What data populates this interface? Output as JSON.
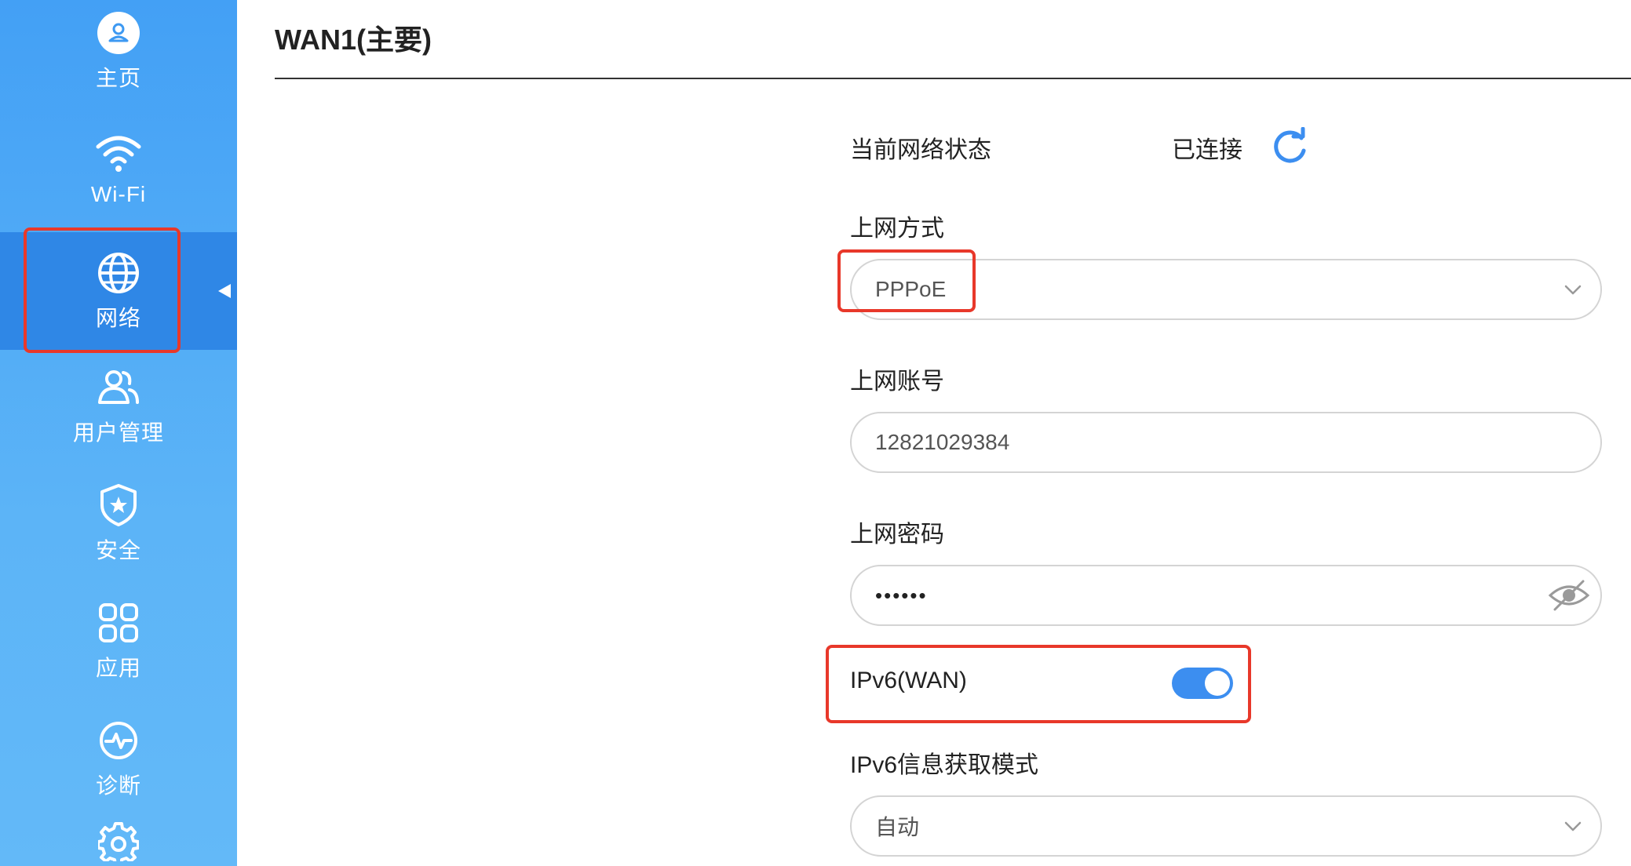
{
  "sidebar": {
    "items": [
      {
        "label": "主页",
        "icon": "home-avatar-icon"
      },
      {
        "label": "Wi-Fi",
        "icon": "wifi-icon"
      },
      {
        "label": "网络",
        "icon": "globe-icon",
        "active": true
      },
      {
        "label": "用户管理",
        "icon": "users-icon"
      },
      {
        "label": "安全",
        "icon": "shield-star-icon"
      },
      {
        "label": "应用",
        "icon": "apps-grid-icon"
      },
      {
        "label": "诊断",
        "icon": "pulse-icon"
      },
      {
        "label": "",
        "icon": "gear-icon"
      }
    ]
  },
  "page": {
    "title": "WAN1(主要)"
  },
  "form": {
    "status": {
      "label": "当前网络状态",
      "value": "已连接",
      "refresh_icon": "refresh-icon"
    },
    "connection_type": {
      "label": "上网方式",
      "value": "PPPoE"
    },
    "account": {
      "label": "上网账号",
      "value": "12821029384"
    },
    "password": {
      "label": "上网密码",
      "value": "••••••"
    },
    "ipv6": {
      "label": "IPv6(WAN)",
      "enabled": true
    },
    "ipv6_mode": {
      "label": "IPv6信息获取模式",
      "value": "自动"
    }
  },
  "colors": {
    "sidebar": "#4fa9f6",
    "sidebar_active": "#2f87e6",
    "accent": "#3c8ef0",
    "highlight": "#e8382a"
  }
}
